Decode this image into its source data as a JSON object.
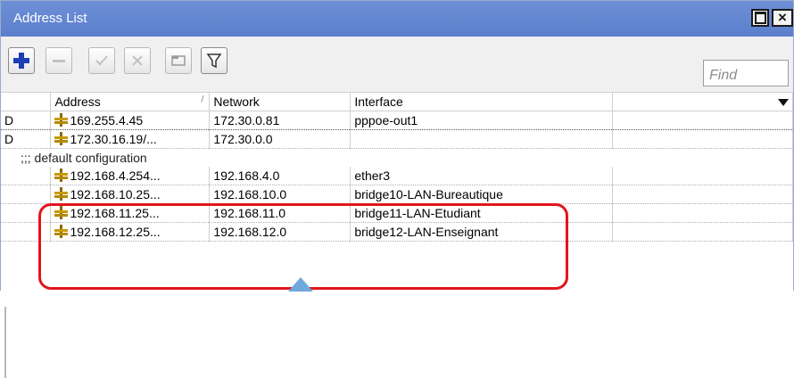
{
  "window": {
    "title": "Address List"
  },
  "toolbar": {
    "buttons": [
      {
        "name": "add-button",
        "icon": "plus-icon"
      },
      {
        "name": "remove-button",
        "icon": "minus-icon"
      },
      {
        "name": "enable-button",
        "icon": "check-icon"
      },
      {
        "name": "disable-button",
        "icon": "cross-icon"
      },
      {
        "name": "comment-button",
        "icon": "comment-icon"
      },
      {
        "name": "filter-button",
        "icon": "filter-icon"
      }
    ],
    "find_placeholder": "Find"
  },
  "table": {
    "columns": [
      "",
      "Address",
      "Network",
      "Interface",
      ""
    ],
    "sort_indicator": "/",
    "rows": [
      {
        "flag": "D",
        "address": "169.255.4.45",
        "network": "172.30.0.81",
        "interface": "pppoe-out1"
      },
      {
        "flag": "D",
        "address": "172.30.16.19/...",
        "network": "172.30.0.0",
        "interface": ""
      },
      {
        "comment": ";;; default configuration"
      },
      {
        "flag": "",
        "address": "192.168.4.254...",
        "network": "192.168.4.0",
        "interface": "ether3"
      },
      {
        "flag": "",
        "address": "192.168.10.25...",
        "network": "192.168.10.0",
        "interface": "bridge10-LAN-Bureautique"
      },
      {
        "flag": "",
        "address": "192.168.11.25...",
        "network": "192.168.11.0",
        "interface": "bridge11-LAN-Etudiant"
      },
      {
        "flag": "",
        "address": "192.168.12.25...",
        "network": "192.168.12.0",
        "interface": "bridge12-LAN-Enseignant"
      }
    ]
  },
  "colors": {
    "titlebar": "#6e8fd6",
    "highlight": "#e1161c",
    "callout": "#6fa8dc"
  }
}
